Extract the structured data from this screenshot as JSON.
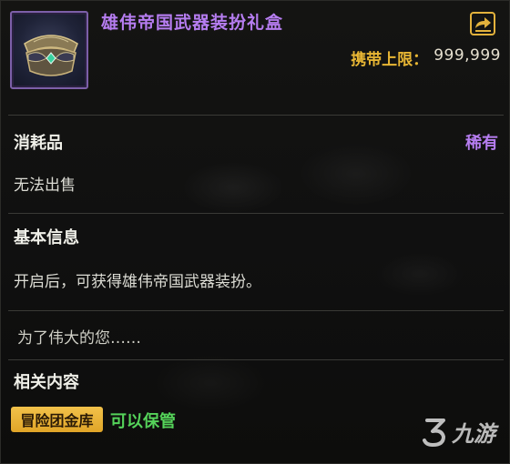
{
  "item": {
    "name": "雄伟帝国武器装扮礼盒",
    "icon": "treasure-box-icon",
    "rarity": "稀有",
    "category": "消耗品",
    "sell_status": "无法出售"
  },
  "carry_limit": {
    "label": "携带上限：",
    "value": "999,999"
  },
  "basic_info": {
    "title": "基本信息",
    "description": "开启后，可获得雄伟帝国武器装扮。"
  },
  "flavor_text": "为了伟大的您……",
  "related": {
    "title": "相关内容",
    "storage_badge": "冒险团金库",
    "storage_status": "可以保管"
  },
  "watermark": {
    "text": "九游"
  },
  "colors": {
    "rarity_purple": "#b67df0",
    "gold": "#e8b634",
    "green": "#55d35a",
    "badge_bg": "#f2c24a"
  }
}
